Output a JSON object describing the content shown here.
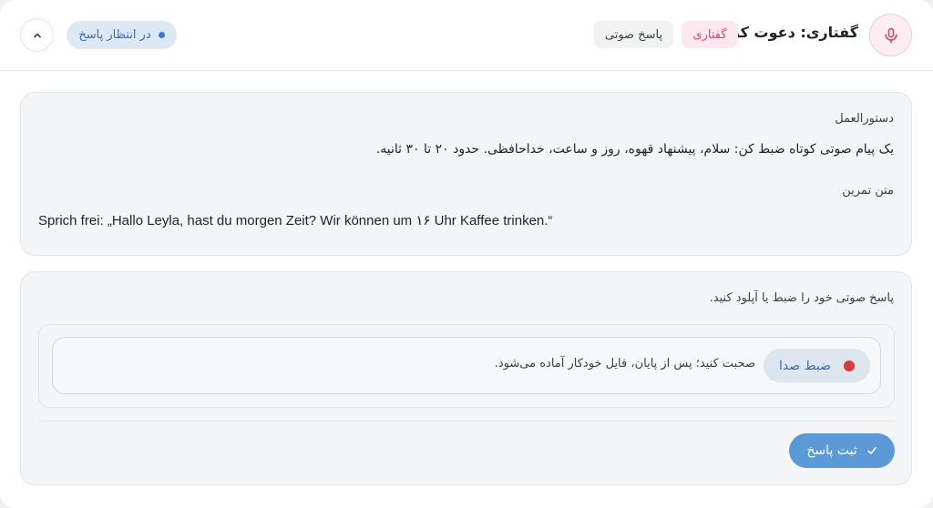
{
  "header": {
    "title": "گفتاری: دعوت کردن",
    "tag_speaking": "گفتاری",
    "tag_voice": "پاسخ صوتی",
    "status": "در انتظار پاسخ"
  },
  "instructions": {
    "label": "دستورالعمل",
    "text": "یک پیام صوتی کوتاه ضبط کن: سلام، پیشنهاد قهوه، روز و ساعت، خداحافظی. حدود ۲۰ تا ۳۰ ثانیه.",
    "exercise_label": "متن تمرین",
    "exercise_text": "Sprich frei: „Hallo Leyla, hast du morgen Zeit? Wir können um ۱۶ Uhr Kaffee trinken.“"
  },
  "answer": {
    "prompt": "پاسخ صوتی خود را ضبط یا آپلود کنید.",
    "record_label": "ضبط صدا",
    "record_hint": "صحبت کنید؛ پس از پایان، فایل خودکار آماده می‌شود.",
    "submit_label": "ثبت پاسخ"
  },
  "icons": {
    "mic": "microphone-icon",
    "chevron": "chevron-up-icon",
    "check": "check-icon"
  }
}
